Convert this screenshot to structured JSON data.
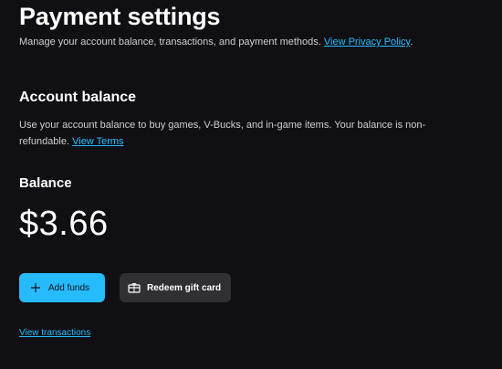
{
  "header": {
    "title": "Payment settings",
    "subtitle": "Manage your account balance, transactions, and payment methods.",
    "privacy_link": "View Privacy Policy",
    "subtitle_end": "."
  },
  "account_balance": {
    "title": "Account balance",
    "description": "Use your account balance to buy games, V-Bucks, and in-game items. Your balance is non-refundable.",
    "terms_link": "View Terms"
  },
  "balance": {
    "label": "Balance",
    "amount": "$3.66"
  },
  "actions": {
    "add_funds": {
      "label": "Add funds",
      "icon": "plus-icon"
    },
    "redeem_gift_card": {
      "label": "Redeem gift card",
      "icon": "gift-card-icon"
    }
  },
  "transactions_link": "View transactions",
  "colors": {
    "background": "#101014",
    "accent": "#26bbff",
    "secondary_button": "#303034",
    "muted_text": "#cfcfd3"
  }
}
